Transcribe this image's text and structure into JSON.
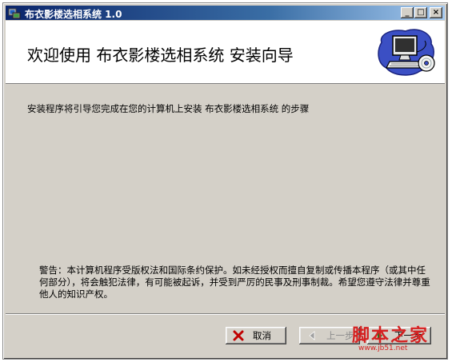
{
  "window": {
    "title": "布衣影楼选相系统 1.0",
    "controls": {
      "minimize": "_",
      "maximize": "□",
      "close": "×"
    }
  },
  "header": {
    "title": "欢迎使用 布衣影楼选相系统 安装向导",
    "art_icon": "computer-disk-icon"
  },
  "body": {
    "intro": "安装程序将引导您完成在您的计算机上安装 布衣影楼选相系统 的步骤",
    "warning": "警告：本计算机程序受版权法和国际条约保护。如未经授权而擅自复制或传播本程序（或其中任何部分），将会触犯法律，有可能被起诉，并受到严厉的民事及刑事制裁。希望您遵守法律并尊重他人的知识产权。"
  },
  "buttons": {
    "cancel": "取消",
    "back": "上一步",
    "next": "下一步"
  },
  "watermark": {
    "main": "脚本之家",
    "sub": "www.jb51.net"
  },
  "colors": {
    "title_bar_start": "#0a246a",
    "title_bar_end": "#a6caf0",
    "panel": "#d4d0c8",
    "cancel_icon": "#c00000",
    "watermark": "#d42020"
  }
}
